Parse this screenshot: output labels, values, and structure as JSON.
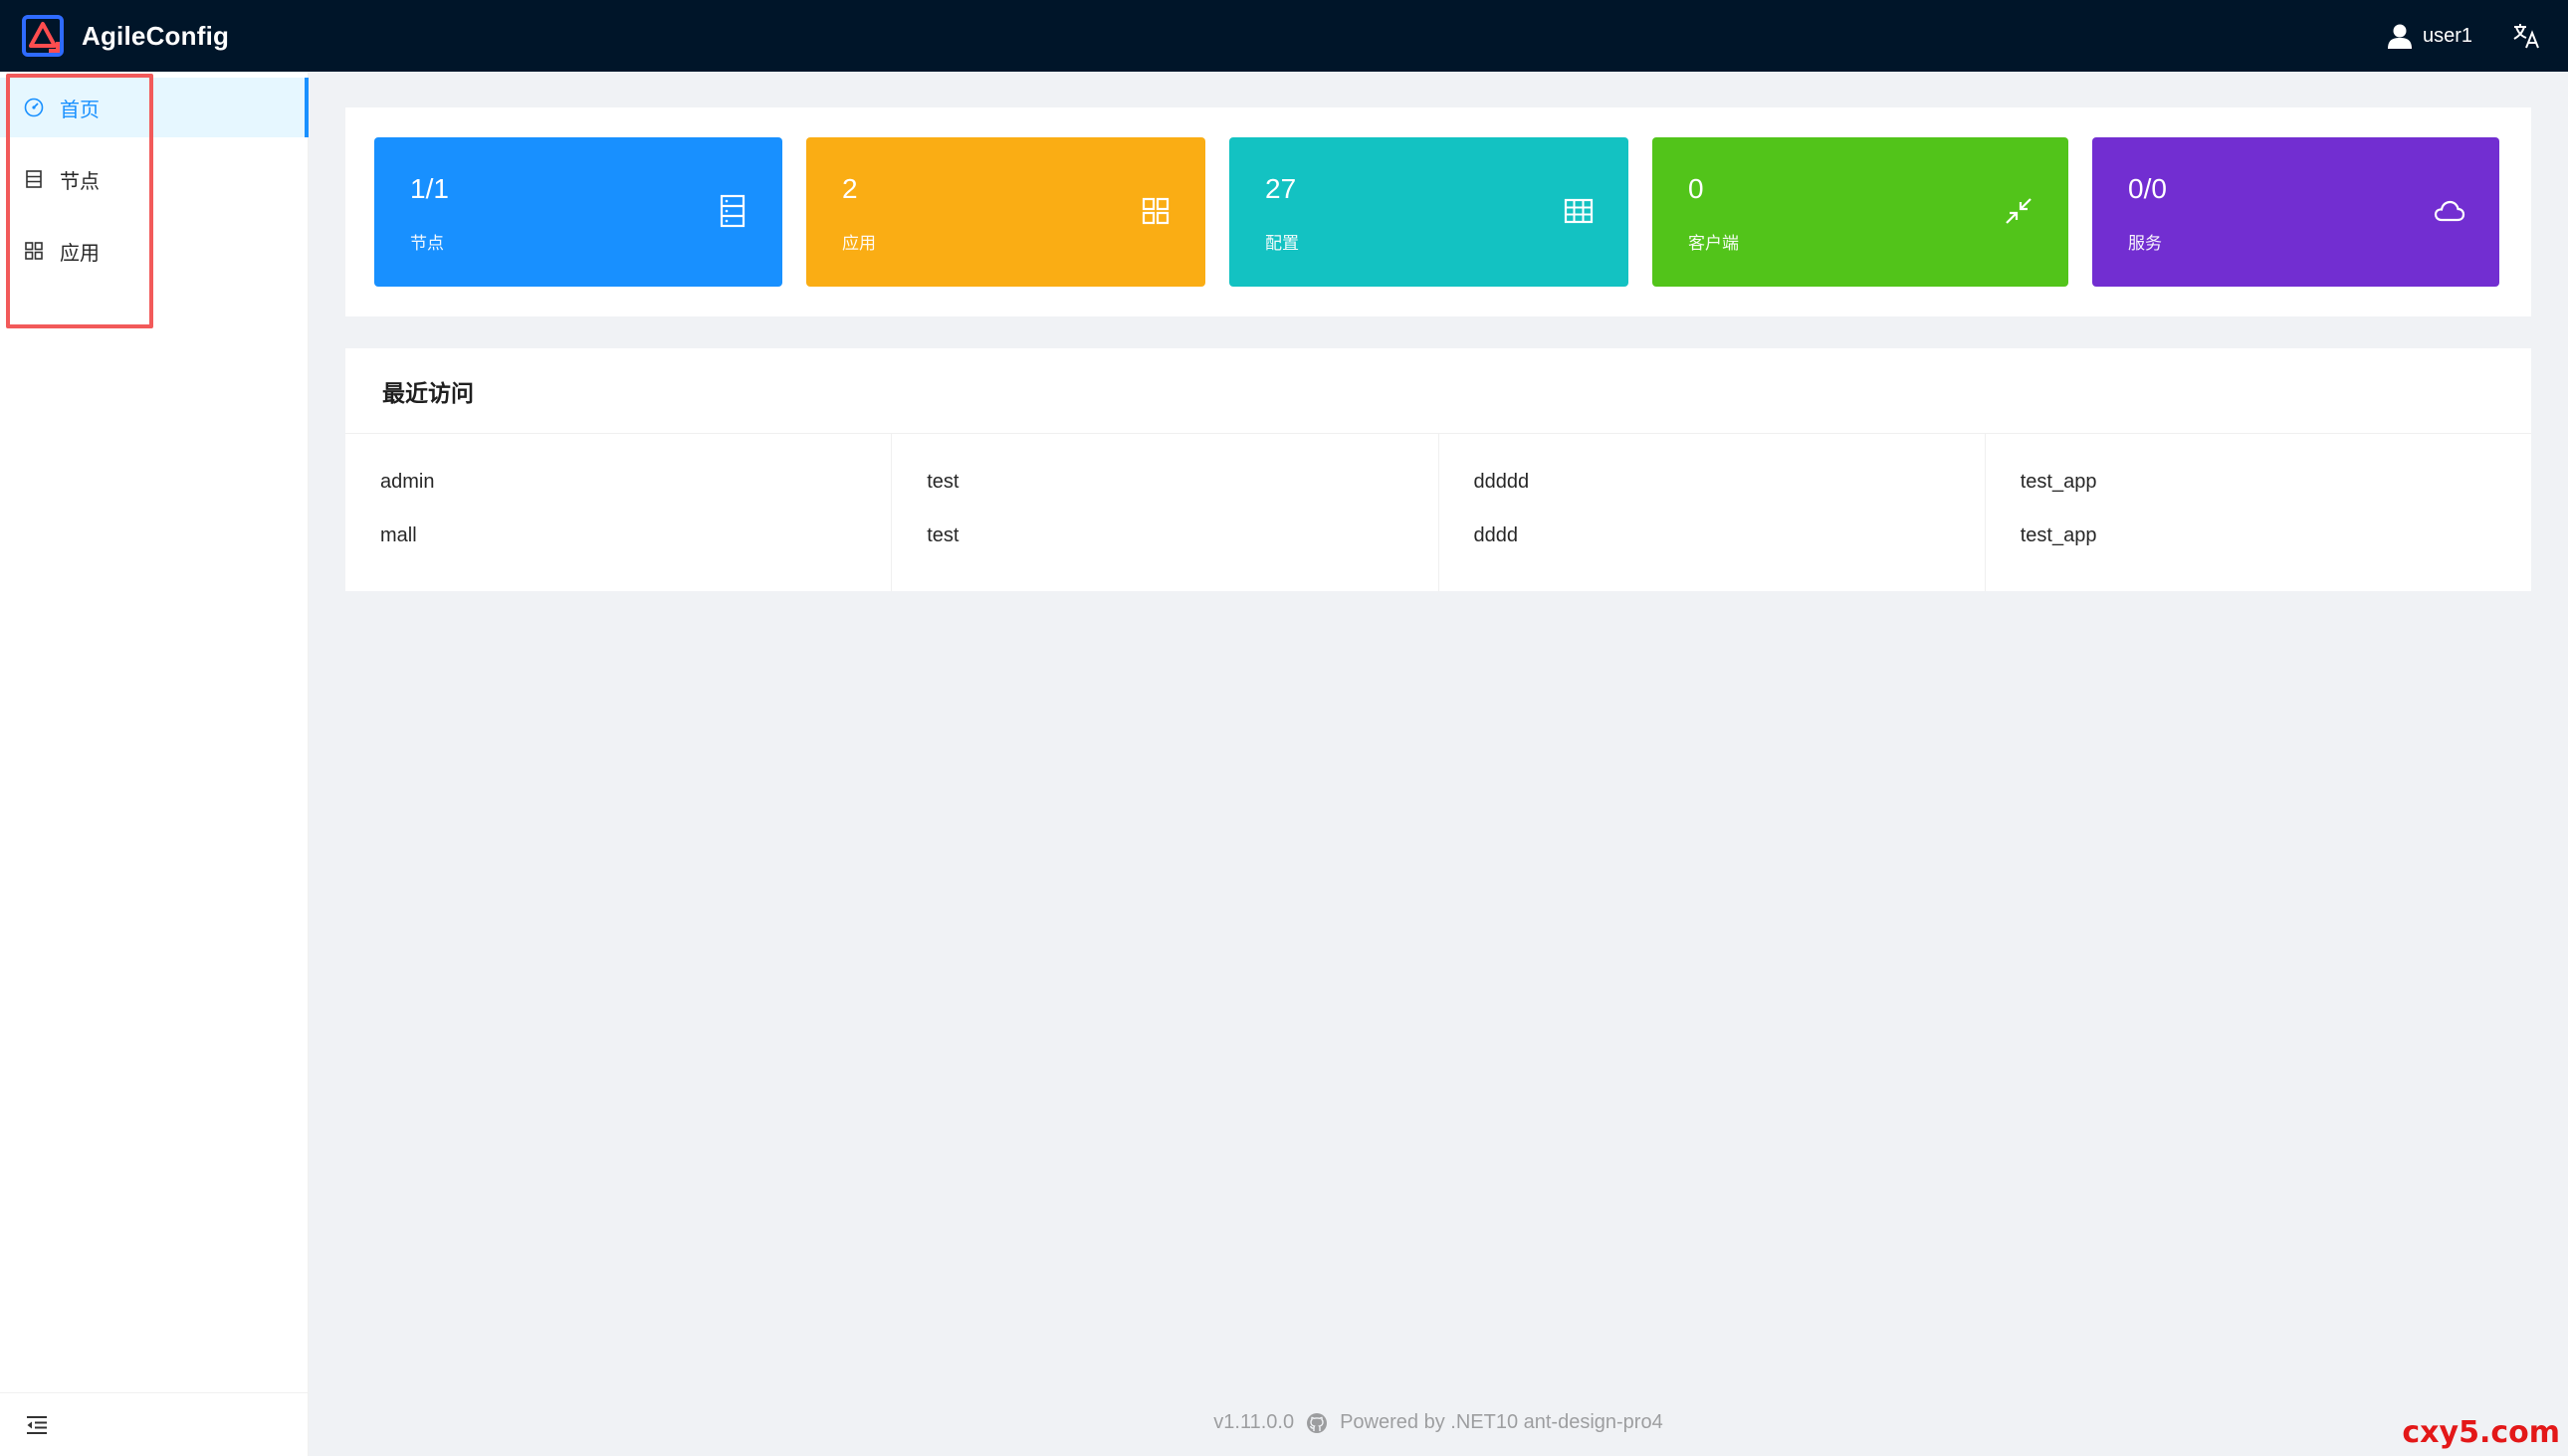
{
  "header": {
    "brand_title": "AgileConfig",
    "user_name": "user1",
    "colors": {
      "background": "#001529"
    }
  },
  "sidebar": {
    "items": [
      {
        "label": "首页",
        "icon": "dashboard-icon",
        "active": true
      },
      {
        "label": "节点",
        "icon": "database-icon",
        "active": false
      },
      {
        "label": "应用",
        "icon": "appstore-icon",
        "active": false
      }
    ],
    "active_color": "#1890ff"
  },
  "stats": [
    {
      "value": "1/1",
      "label": "节点",
      "color": "#1890ff",
      "icon": "database-icon"
    },
    {
      "value": "2",
      "label": "应用",
      "color": "#faad14",
      "icon": "appstore-icon"
    },
    {
      "value": "27",
      "label": "配置",
      "color": "#13c2c2",
      "icon": "table-icon"
    },
    {
      "value": "0",
      "label": "客户端",
      "color": "#52c41a",
      "icon": "shrink-icon"
    },
    {
      "value": "0/0",
      "label": "服务",
      "color": "#722ed1",
      "icon": "cloud-icon"
    }
  ],
  "recent": {
    "title": "最近访问",
    "columns": [
      [
        "admin",
        "mall"
      ],
      [
        "test",
        "test"
      ],
      [
        "ddddd",
        "dddd"
      ],
      [
        "test_app",
        "test_app"
      ]
    ]
  },
  "footer": {
    "version": "v1.11.0.0",
    "powered": "Powered by .NET10 ant-design-pro4"
  },
  "watermark": "cxy5.com"
}
